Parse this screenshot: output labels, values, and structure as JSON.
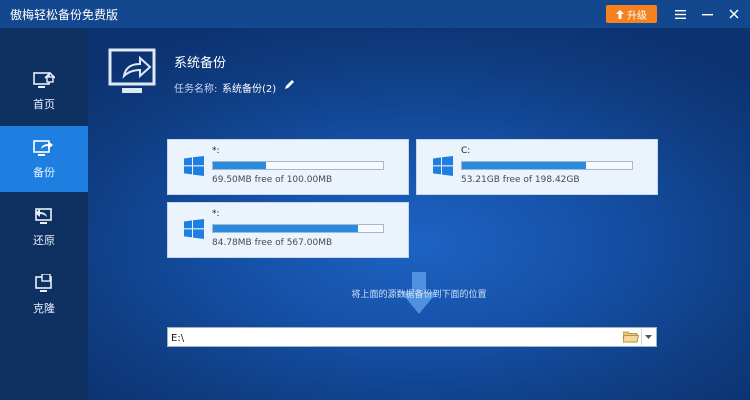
{
  "app": {
    "title": "傲梅轻松备份免费版",
    "upgrade_label": "升级"
  },
  "sidebar": {
    "items": [
      {
        "label": "首页",
        "icon": "home-icon",
        "active": false
      },
      {
        "label": "备份",
        "icon": "backup-icon",
        "active": true
      },
      {
        "label": "还原",
        "icon": "restore-icon",
        "active": false
      },
      {
        "label": "克隆",
        "icon": "clone-icon",
        "active": false
      }
    ]
  },
  "header": {
    "title": "系统备份",
    "task_label": "任务名称:",
    "task_value": "系统备份(2)"
  },
  "disks": [
    {
      "name": "*:",
      "free_text": "69.50MB free of 100.00MB",
      "used_fraction": 0.31
    },
    {
      "name": "C:",
      "free_text": "53.21GB free of 198.42GB",
      "used_fraction": 0.73
    },
    {
      "name": "*:",
      "free_text": "84.78MB free of 567.00MB",
      "used_fraction": 0.85
    }
  ],
  "hint": "将上面的源数据备份到下面的位置",
  "destination": {
    "value": "E:\\"
  },
  "colors": {
    "titlebar": "#14488e",
    "sidebar": "#0e3161",
    "active": "#1e7fe0",
    "upgrade": "#f5821f",
    "bar_fill": "#2a8ae0"
  }
}
